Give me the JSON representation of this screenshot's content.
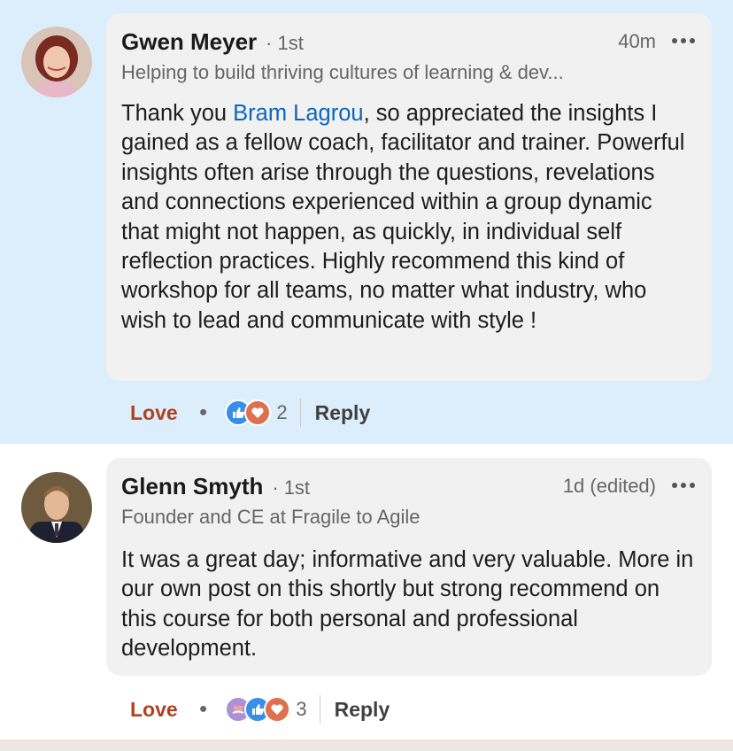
{
  "comments": [
    {
      "author": "Gwen Meyer",
      "degree": "1st",
      "time": "40m",
      "headline": "Helping to build thriving cultures of learning & dev...",
      "mention": "Bram Lagrou",
      "text_before": "Thank you ",
      "text_after": ", so appreciated the insights I gained as a fellow coach, facilitator and trainer.  Powerful insights often arise through the questions, revelations and connections experienced within a group dynamic that might not happen, as quickly, in individual self reflection practices. Highly recommend this kind of workshop for all teams, no matter what industry, who wish to lead and communicate with style !",
      "love_label": "Love",
      "reaction_icons": [
        "like-icon",
        "love-icon"
      ],
      "reaction_count": "2",
      "reply_label": "Reply"
    },
    {
      "author": "Glenn Smyth",
      "degree": "1st",
      "time": "1d (edited)",
      "headline": "Founder and CE at Fragile to Agile",
      "text": "It was a great day; informative and very valuable. More in our own post on this shortly but strong recommend on this course for both personal and professional  development.",
      "love_label": "Love",
      "reaction_icons": [
        "support-icon",
        "like-icon",
        "love-icon"
      ],
      "reaction_count": "3",
      "reply_label": "Reply"
    }
  ],
  "colors": {
    "highlight_bg": "#dceefc",
    "bubble_bg": "#f1f1f1",
    "mention": "#0a66c2",
    "love": "#b24020"
  }
}
